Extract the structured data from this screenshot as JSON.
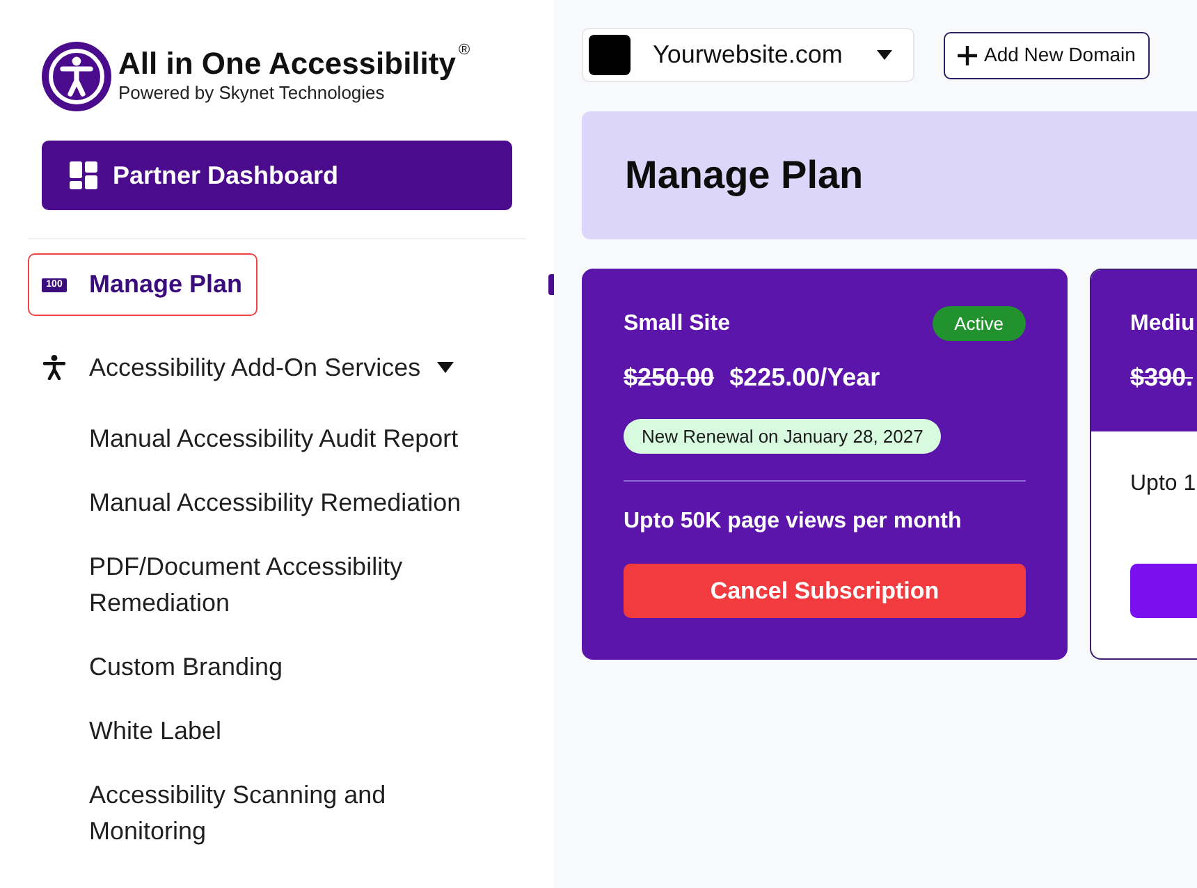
{
  "logo": {
    "title": "All in One Accessibility",
    "mark": "®",
    "subtitle": "Powered by Skynet Technologies"
  },
  "sidebar": {
    "dashboard_button": "Partner Dashboard",
    "items": [
      {
        "kind": "link",
        "badge": "100",
        "label": "Manage Plan",
        "selected": true,
        "focused": true
      },
      {
        "kind": "group",
        "label": "Accessibility Add-On Services",
        "selected": false,
        "focused": false,
        "expanded": true,
        "children": [
          {
            "label": "Manual Accessibility Audit Report",
            "selected": false
          },
          {
            "label": "Manual Accessibility Remediation",
            "selected": false
          },
          {
            "label": "PDF/Document Accessibility Remediation",
            "selected": false
          },
          {
            "label": "Custom Branding",
            "selected": false
          },
          {
            "label": "White Label",
            "selected": false
          },
          {
            "label": "Accessibility Scanning and Monitoring",
            "selected": false
          }
        ]
      }
    ]
  },
  "domain_select": {
    "value": "Yourwebsite.com"
  },
  "add_domain_button": "Add New Domain",
  "page_title": "Manage Plan",
  "plans": [
    {
      "name": "Small Site",
      "status": "Active",
      "old_price": "$250.00",
      "price": "$225.00/Year",
      "renewal": "New Renewal on January 28, 2027",
      "feature": "Upto 50K page views per month",
      "button": "Cancel Subscription",
      "current": true
    },
    {
      "name": "Mediu",
      "old_price": "$390.",
      "feature": "Upto 1",
      "current": false
    }
  ]
}
